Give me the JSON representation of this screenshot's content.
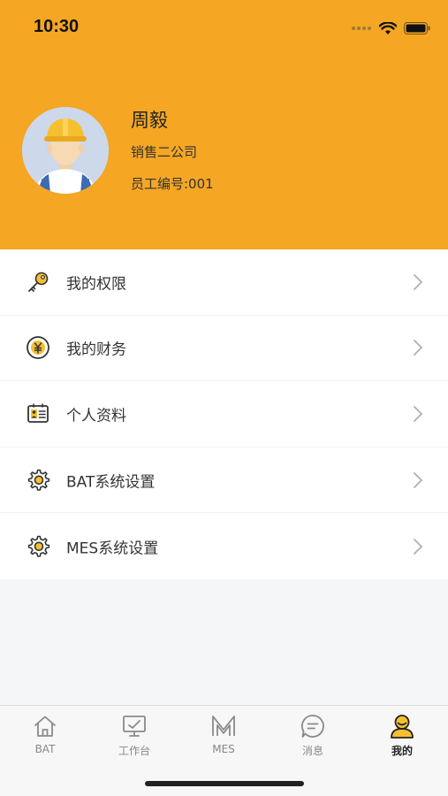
{
  "status_bar": {
    "time": "10:30"
  },
  "profile": {
    "name": "周毅",
    "department": "销售二公司",
    "employee_id": "员工编号:001"
  },
  "menu": {
    "items": [
      {
        "label": "我的权限",
        "icon": "key-icon"
      },
      {
        "label": "我的财务",
        "icon": "yen-coin-icon"
      },
      {
        "label": "个人资料",
        "icon": "id-card-icon"
      },
      {
        "label": "BAT系统设置",
        "icon": "gear-icon"
      },
      {
        "label": "MES系统设置",
        "icon": "gear-icon"
      }
    ]
  },
  "tabbar": {
    "tabs": [
      {
        "label": "BAT",
        "icon": "home-icon"
      },
      {
        "label": "工作台",
        "icon": "monitor-icon"
      },
      {
        "label": "MES",
        "icon": "m-icon"
      },
      {
        "label": "消息",
        "icon": "chat-icon"
      },
      {
        "label": "我的",
        "icon": "person-icon",
        "active": true
      }
    ]
  },
  "colors": {
    "accent": "#f5a623",
    "icon_yellow": "#f5c030",
    "text": "#333333"
  }
}
